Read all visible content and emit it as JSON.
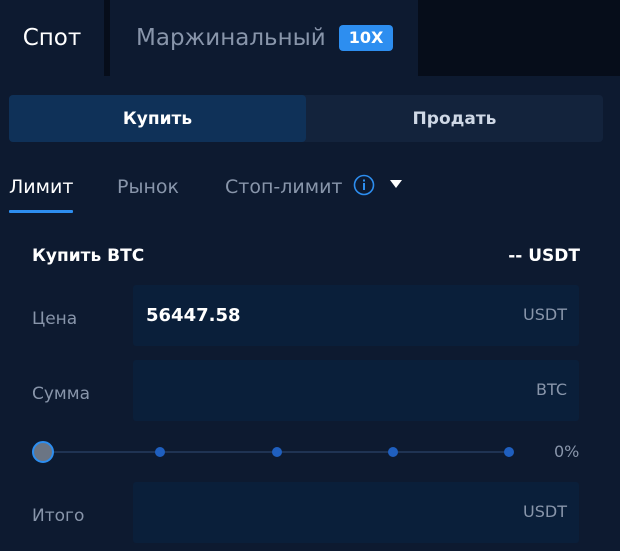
{
  "tabs": {
    "spot_label": "Спот",
    "margin_label": "Маржинальный",
    "margin_badge": "10X"
  },
  "side": {
    "buy_label": "Купить",
    "sell_label": "Продать",
    "active": "buy"
  },
  "order_types": {
    "limit": "Лимит",
    "market": "Рынок",
    "stop_limit": "Стоп-лимит",
    "active": "limit"
  },
  "buy_panel": {
    "title": "Купить BTC",
    "balance": "-- USDT"
  },
  "fields": {
    "price": {
      "label": "Цена",
      "value": "56447.58",
      "unit": "USDT"
    },
    "amount": {
      "label": "Сумма",
      "value": "",
      "unit": "BTC"
    },
    "total": {
      "label": "Итого",
      "value": "",
      "unit": "USDT"
    }
  },
  "slider": {
    "percent_label": "0%",
    "value_fraction": 0,
    "stops": [
      0,
      25,
      50,
      75,
      100
    ]
  },
  "colors": {
    "accent": "#2d8ef0",
    "background": "#0d1a30",
    "input_bg": "#0a1f3a"
  }
}
